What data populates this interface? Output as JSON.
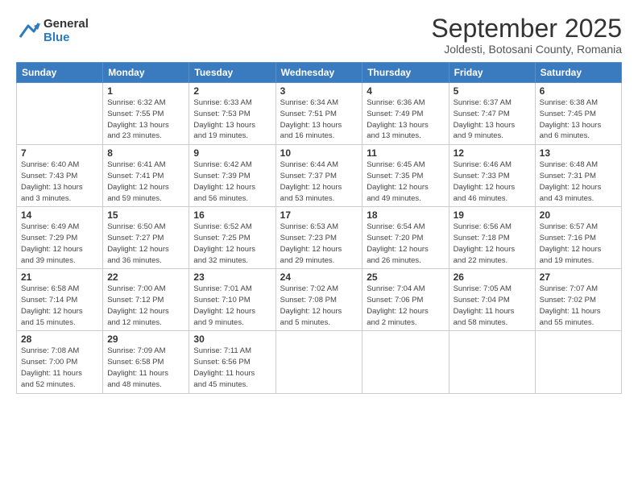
{
  "logo": {
    "general": "General",
    "blue": "Blue"
  },
  "title": "September 2025",
  "subtitle": "Joldesti, Botosani County, Romania",
  "days_of_week": [
    "Sunday",
    "Monday",
    "Tuesday",
    "Wednesday",
    "Thursday",
    "Friday",
    "Saturday"
  ],
  "weeks": [
    [
      {
        "day": "",
        "info": ""
      },
      {
        "day": "1",
        "info": "Sunrise: 6:32 AM\nSunset: 7:55 PM\nDaylight: 13 hours\nand 23 minutes."
      },
      {
        "day": "2",
        "info": "Sunrise: 6:33 AM\nSunset: 7:53 PM\nDaylight: 13 hours\nand 19 minutes."
      },
      {
        "day": "3",
        "info": "Sunrise: 6:34 AM\nSunset: 7:51 PM\nDaylight: 13 hours\nand 16 minutes."
      },
      {
        "day": "4",
        "info": "Sunrise: 6:36 AM\nSunset: 7:49 PM\nDaylight: 13 hours\nand 13 minutes."
      },
      {
        "day": "5",
        "info": "Sunrise: 6:37 AM\nSunset: 7:47 PM\nDaylight: 13 hours\nand 9 minutes."
      },
      {
        "day": "6",
        "info": "Sunrise: 6:38 AM\nSunset: 7:45 PM\nDaylight: 13 hours\nand 6 minutes."
      }
    ],
    [
      {
        "day": "7",
        "info": "Sunrise: 6:40 AM\nSunset: 7:43 PM\nDaylight: 13 hours\nand 3 minutes."
      },
      {
        "day": "8",
        "info": "Sunrise: 6:41 AM\nSunset: 7:41 PM\nDaylight: 12 hours\nand 59 minutes."
      },
      {
        "day": "9",
        "info": "Sunrise: 6:42 AM\nSunset: 7:39 PM\nDaylight: 12 hours\nand 56 minutes."
      },
      {
        "day": "10",
        "info": "Sunrise: 6:44 AM\nSunset: 7:37 PM\nDaylight: 12 hours\nand 53 minutes."
      },
      {
        "day": "11",
        "info": "Sunrise: 6:45 AM\nSunset: 7:35 PM\nDaylight: 12 hours\nand 49 minutes."
      },
      {
        "day": "12",
        "info": "Sunrise: 6:46 AM\nSunset: 7:33 PM\nDaylight: 12 hours\nand 46 minutes."
      },
      {
        "day": "13",
        "info": "Sunrise: 6:48 AM\nSunset: 7:31 PM\nDaylight: 12 hours\nand 43 minutes."
      }
    ],
    [
      {
        "day": "14",
        "info": "Sunrise: 6:49 AM\nSunset: 7:29 PM\nDaylight: 12 hours\nand 39 minutes."
      },
      {
        "day": "15",
        "info": "Sunrise: 6:50 AM\nSunset: 7:27 PM\nDaylight: 12 hours\nand 36 minutes."
      },
      {
        "day": "16",
        "info": "Sunrise: 6:52 AM\nSunset: 7:25 PM\nDaylight: 12 hours\nand 32 minutes."
      },
      {
        "day": "17",
        "info": "Sunrise: 6:53 AM\nSunset: 7:23 PM\nDaylight: 12 hours\nand 29 minutes."
      },
      {
        "day": "18",
        "info": "Sunrise: 6:54 AM\nSunset: 7:20 PM\nDaylight: 12 hours\nand 26 minutes."
      },
      {
        "day": "19",
        "info": "Sunrise: 6:56 AM\nSunset: 7:18 PM\nDaylight: 12 hours\nand 22 minutes."
      },
      {
        "day": "20",
        "info": "Sunrise: 6:57 AM\nSunset: 7:16 PM\nDaylight: 12 hours\nand 19 minutes."
      }
    ],
    [
      {
        "day": "21",
        "info": "Sunrise: 6:58 AM\nSunset: 7:14 PM\nDaylight: 12 hours\nand 15 minutes."
      },
      {
        "day": "22",
        "info": "Sunrise: 7:00 AM\nSunset: 7:12 PM\nDaylight: 12 hours\nand 12 minutes."
      },
      {
        "day": "23",
        "info": "Sunrise: 7:01 AM\nSunset: 7:10 PM\nDaylight: 12 hours\nand 9 minutes."
      },
      {
        "day": "24",
        "info": "Sunrise: 7:02 AM\nSunset: 7:08 PM\nDaylight: 12 hours\nand 5 minutes."
      },
      {
        "day": "25",
        "info": "Sunrise: 7:04 AM\nSunset: 7:06 PM\nDaylight: 12 hours\nand 2 minutes."
      },
      {
        "day": "26",
        "info": "Sunrise: 7:05 AM\nSunset: 7:04 PM\nDaylight: 11 hours\nand 58 minutes."
      },
      {
        "day": "27",
        "info": "Sunrise: 7:07 AM\nSunset: 7:02 PM\nDaylight: 11 hours\nand 55 minutes."
      }
    ],
    [
      {
        "day": "28",
        "info": "Sunrise: 7:08 AM\nSunset: 7:00 PM\nDaylight: 11 hours\nand 52 minutes."
      },
      {
        "day": "29",
        "info": "Sunrise: 7:09 AM\nSunset: 6:58 PM\nDaylight: 11 hours\nand 48 minutes."
      },
      {
        "day": "30",
        "info": "Sunrise: 7:11 AM\nSunset: 6:56 PM\nDaylight: 11 hours\nand 45 minutes."
      },
      {
        "day": "",
        "info": ""
      },
      {
        "day": "",
        "info": ""
      },
      {
        "day": "",
        "info": ""
      },
      {
        "day": "",
        "info": ""
      }
    ]
  ]
}
